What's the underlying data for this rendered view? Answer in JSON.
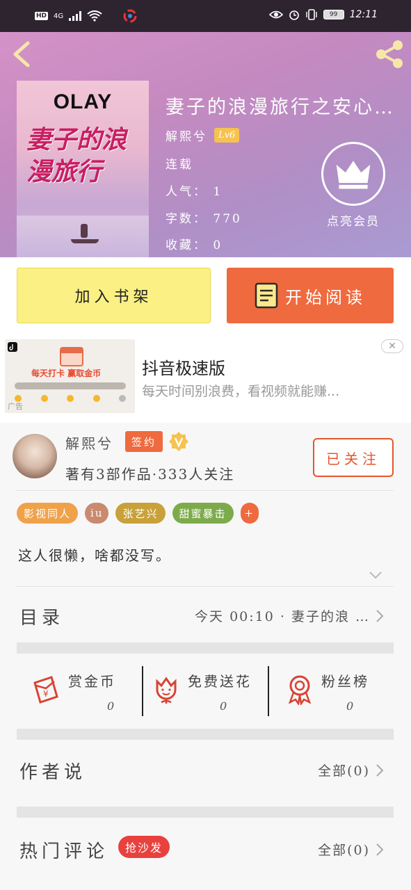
{
  "status_bar": {
    "hd": "HD",
    "network": "4G",
    "time": "12:11",
    "battery": "99"
  },
  "book": {
    "cover_brand": "OLAY",
    "cover_title": "妻子的浪漫旅行",
    "title": "妻子的浪漫旅行之安心…",
    "author": "解熙兮",
    "level": "Lv6",
    "status": "连载",
    "popularity": "人气： 1",
    "word_count": "字数： 770",
    "favorites": "收藏： 0",
    "vip_label": "点亮会员"
  },
  "actions": {
    "add_shelf": "加入书架",
    "start_read": "开始阅读"
  },
  "ad": {
    "title": "抖音极速版",
    "description": "每天时间别浪费，看视频就能赚...",
    "banner": "每天打卡  赢取金币",
    "tag": "广告",
    "close": "✕"
  },
  "author_card": {
    "name": "解熙兮",
    "sign_badge": "签约",
    "works": "著有3部作品·333人关注",
    "follow_label": "已关注",
    "tags": [
      "影视同人",
      "iu",
      "张艺兴",
      "甜蜜暴击",
      "+"
    ],
    "bio": "这人很懒，啥都没写。"
  },
  "catalog": {
    "label": "目录",
    "latest": "今天  00:10 · 妻子的浪 …"
  },
  "stats": [
    {
      "label": "赏金币",
      "value": "0"
    },
    {
      "label": "免费送花",
      "value": "0"
    },
    {
      "label": "粉丝榜",
      "value": "0"
    }
  ],
  "author_say": {
    "label": "作者说",
    "all": "全部(0)"
  },
  "hot_comments": {
    "label": "热门评论",
    "badge": "抢沙发",
    "all": "全部(0)"
  },
  "colors": {
    "accent": "#ef6a3e",
    "shelf_button": "#fbf084",
    "status_bar": "#2e2430"
  }
}
